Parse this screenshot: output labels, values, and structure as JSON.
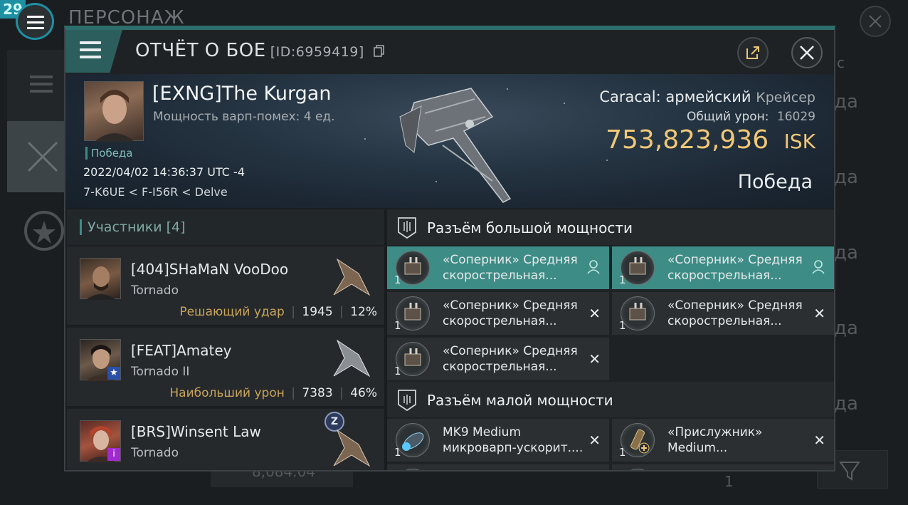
{
  "background": {
    "level_badge": "29",
    "screen_title": "ПЕРСОНАЖ",
    "victory_fragments": [
      "да",
      "да",
      "да",
      "да",
      "да"
    ],
    "c_fragment": "c",
    "bottom_value": "8,084.04",
    "bottom_count": "1"
  },
  "header": {
    "title": "ОТЧЁТ О БОЕ",
    "id_label": "[ID:6959419]"
  },
  "victim": {
    "name": "[EXNG]The Kurgan",
    "warp_disruption": "Мощность варп-помех: 4 ед.",
    "result_tag": "Победа",
    "datetime": "2022/04/02 14:36:37 UTC -4",
    "location": "7-K6UE < F-I56R < Delve",
    "ship_name": "Caracal: армейский",
    "ship_class": "Крейсер",
    "total_damage_label": "Общий урон:",
    "total_damage_value": "16029",
    "isk_value": "753,823,936",
    "isk_unit": "ISK",
    "outcome": "Победа"
  },
  "participants": {
    "label": "Участники",
    "count": "[4]",
    "rows": [
      {
        "name": "[404]SHaMaN VooDoo",
        "ship": "Tornado",
        "tag": "Решающий удар",
        "damage": "1945",
        "percent": "12%"
      },
      {
        "name": "[FEAT]Amatey",
        "ship": "Tornado II",
        "tag": "Наибольший урон",
        "damage": "7383",
        "percent": "46%"
      },
      {
        "name": "[BRS]Winsent Law",
        "ship": "Tornado",
        "badge": "Z"
      }
    ]
  },
  "fitting": {
    "high": {
      "label": "Разъём большой мощности",
      "slots": [
        {
          "qty": "1",
          "name1": "«Соперник» Средняя",
          "name2": "скорострельная...",
          "icon": "turret-icon",
          "action": "pilot-icon"
        },
        {
          "qty": "1",
          "name1": "«Соперник» Средняя",
          "name2": "скорострельная...",
          "icon": "turret-icon",
          "action": "pilot-icon"
        },
        {
          "qty": "1",
          "name1": "«Соперник» Средняя",
          "name2": "скорострельная...",
          "icon": "turret-icon",
          "action": "✕"
        },
        {
          "qty": "1",
          "name1": "«Соперник» Средняя",
          "name2": "скорострельная...",
          "icon": "turret-icon",
          "action": "✕"
        },
        {
          "qty": "1",
          "name1": "«Соперник» Средняя",
          "name2": "скорострельная...",
          "icon": "turret-icon",
          "action": "✕"
        }
      ]
    },
    "mid": {
      "label": "Разъём малой мощности",
      "slots": [
        {
          "qty": "1",
          "name1": "MK9 Medium",
          "name2": "микроварп-ускорит....",
          "icon": "microwarpdrive-icon",
          "action": "✕"
        },
        {
          "qty": "1",
          "name1": "«Прислужник»",
          "name2": "Medium...",
          "icon": "capacitor-booster-icon",
          "action": "✕"
        }
      ]
    }
  },
  "colors": {
    "accent_teal": "#2d6e6c",
    "highlight_slot": "#3d8c85",
    "isk_gold": "#f1c877",
    "tag_gold": "#c9a45a"
  }
}
